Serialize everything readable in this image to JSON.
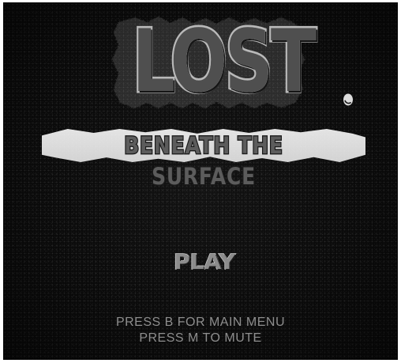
{
  "game": {
    "title_main": "LOST",
    "title_sub": "BENEATH THE SURFACE",
    "play_label": "PLAY",
    "hint_main_menu": "PRESS B FOR MAIN MENU",
    "hint_mute": "PRESS M TO MUTE"
  },
  "colors": {
    "background": "#0b0b0b",
    "title_fill": "#4f4f4f",
    "title_stroke": "#b9b9b9",
    "subtitle_plate": "#e6e6e6",
    "play_text": "#8c8c8c",
    "hint_text": "#8e8e8e"
  }
}
